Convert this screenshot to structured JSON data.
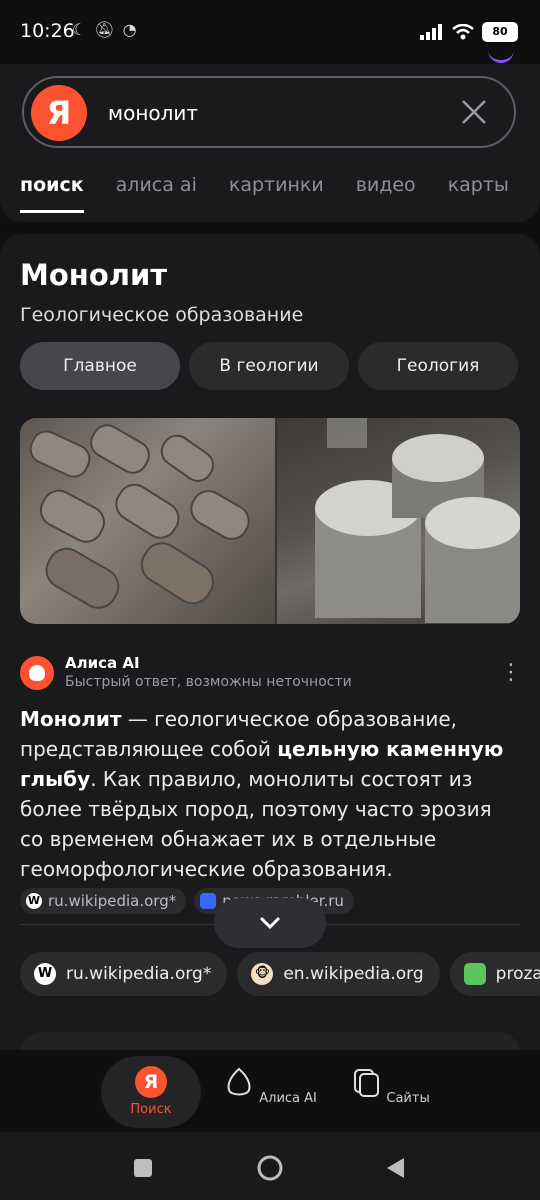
{
  "status": {
    "time": "10:26",
    "battery": "80"
  },
  "search": {
    "query": "монолит",
    "logo": "Я"
  },
  "tabs": [
    "поиск",
    "алиса ai",
    "картинки",
    "видео",
    "карты"
  ],
  "entity": {
    "title": "Монолит",
    "subtitle": "Геологическое образование",
    "chips": [
      "Главное",
      "В геологии",
      "Геология"
    ]
  },
  "alisa": {
    "name": "Алиса AI",
    "note": "Быстрый ответ, возможны неточности",
    "answer": {
      "p1_bold": "Монолит",
      "p2": " — геологическое образование, представляющее собой ",
      "p3_bold": "цельную каменную глыбу",
      "p4": ". Как правило, монолиты состоят из более твёрдых пород, поэтому часто эрозия со временем обнажает их в отдельные геоморфологические образования."
    },
    "inline_sources": [
      "ru.wikipedia.org*",
      "news.rambler.ru"
    ]
  },
  "sources": [
    "ru.wikipedia.org*",
    "en.wikipedia.org",
    "proza"
  ],
  "bottom_nav": {
    "search": "Поиск",
    "alisa": "Алиса AI",
    "sites": "Сайты",
    "logo": "Я"
  },
  "colors": {
    "accent": "#fc5230",
    "background": "#1a1a1c"
  }
}
